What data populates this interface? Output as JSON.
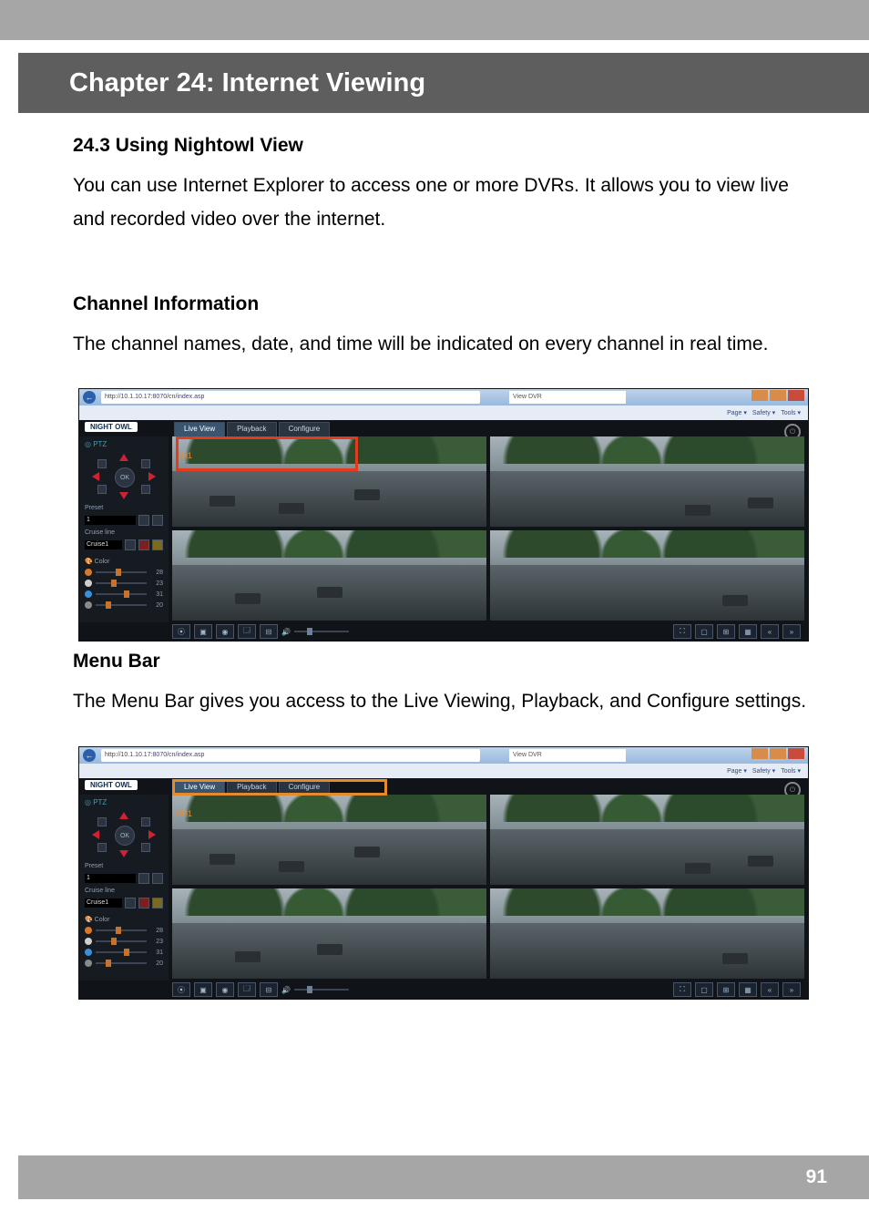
{
  "chapter_title": "Chapter 24: Internet Viewing",
  "section_1_title": "24.3 Using Nightowl View",
  "section_1_body": "You can use Internet Explorer to access one or more DVRs. It allows you to view live and recorded video over the internet.",
  "section_2_title": "Channel Information",
  "section_2_body": "The channel names, date, and time will be indicated on every channel in real time.",
  "section_3_title": "Menu Bar",
  "section_3_body": "The Menu Bar gives you access to the Live Viewing, Playback, and Configure settings.",
  "page_number": "91",
  "browser": {
    "url": "http://10.1.10.17:8070/cn/index.asp",
    "search": "View DVR",
    "ie_menus": [
      "Page ▾",
      "Safety ▾",
      "Tools ▾"
    ]
  },
  "app": {
    "brand": "NIGHT OWL",
    "ptz_label": "PTZ",
    "ok": "OK",
    "preset_label": "Preset",
    "preset_value": "1",
    "cruise_label": "Cruise line",
    "cruise_value": "Cruise1",
    "color_label": "Color",
    "sliders": [
      {
        "value": "28",
        "color": "#d9772a"
      },
      {
        "value": "23",
        "color": "#cfcfcf"
      },
      {
        "value": "31",
        "color": "#3b8fd6"
      },
      {
        "value": "20",
        "color": "#8a8a8a"
      }
    ],
    "tabs": {
      "live": "Live View",
      "playback": "Playback",
      "configure": "Configure"
    },
    "cams": [
      {
        "label": "CH1",
        "time": ""
      },
      {
        "label": "",
        "time": ""
      },
      {
        "label": "",
        "time": ""
      },
      {
        "label": "",
        "time": ""
      }
    ]
  }
}
